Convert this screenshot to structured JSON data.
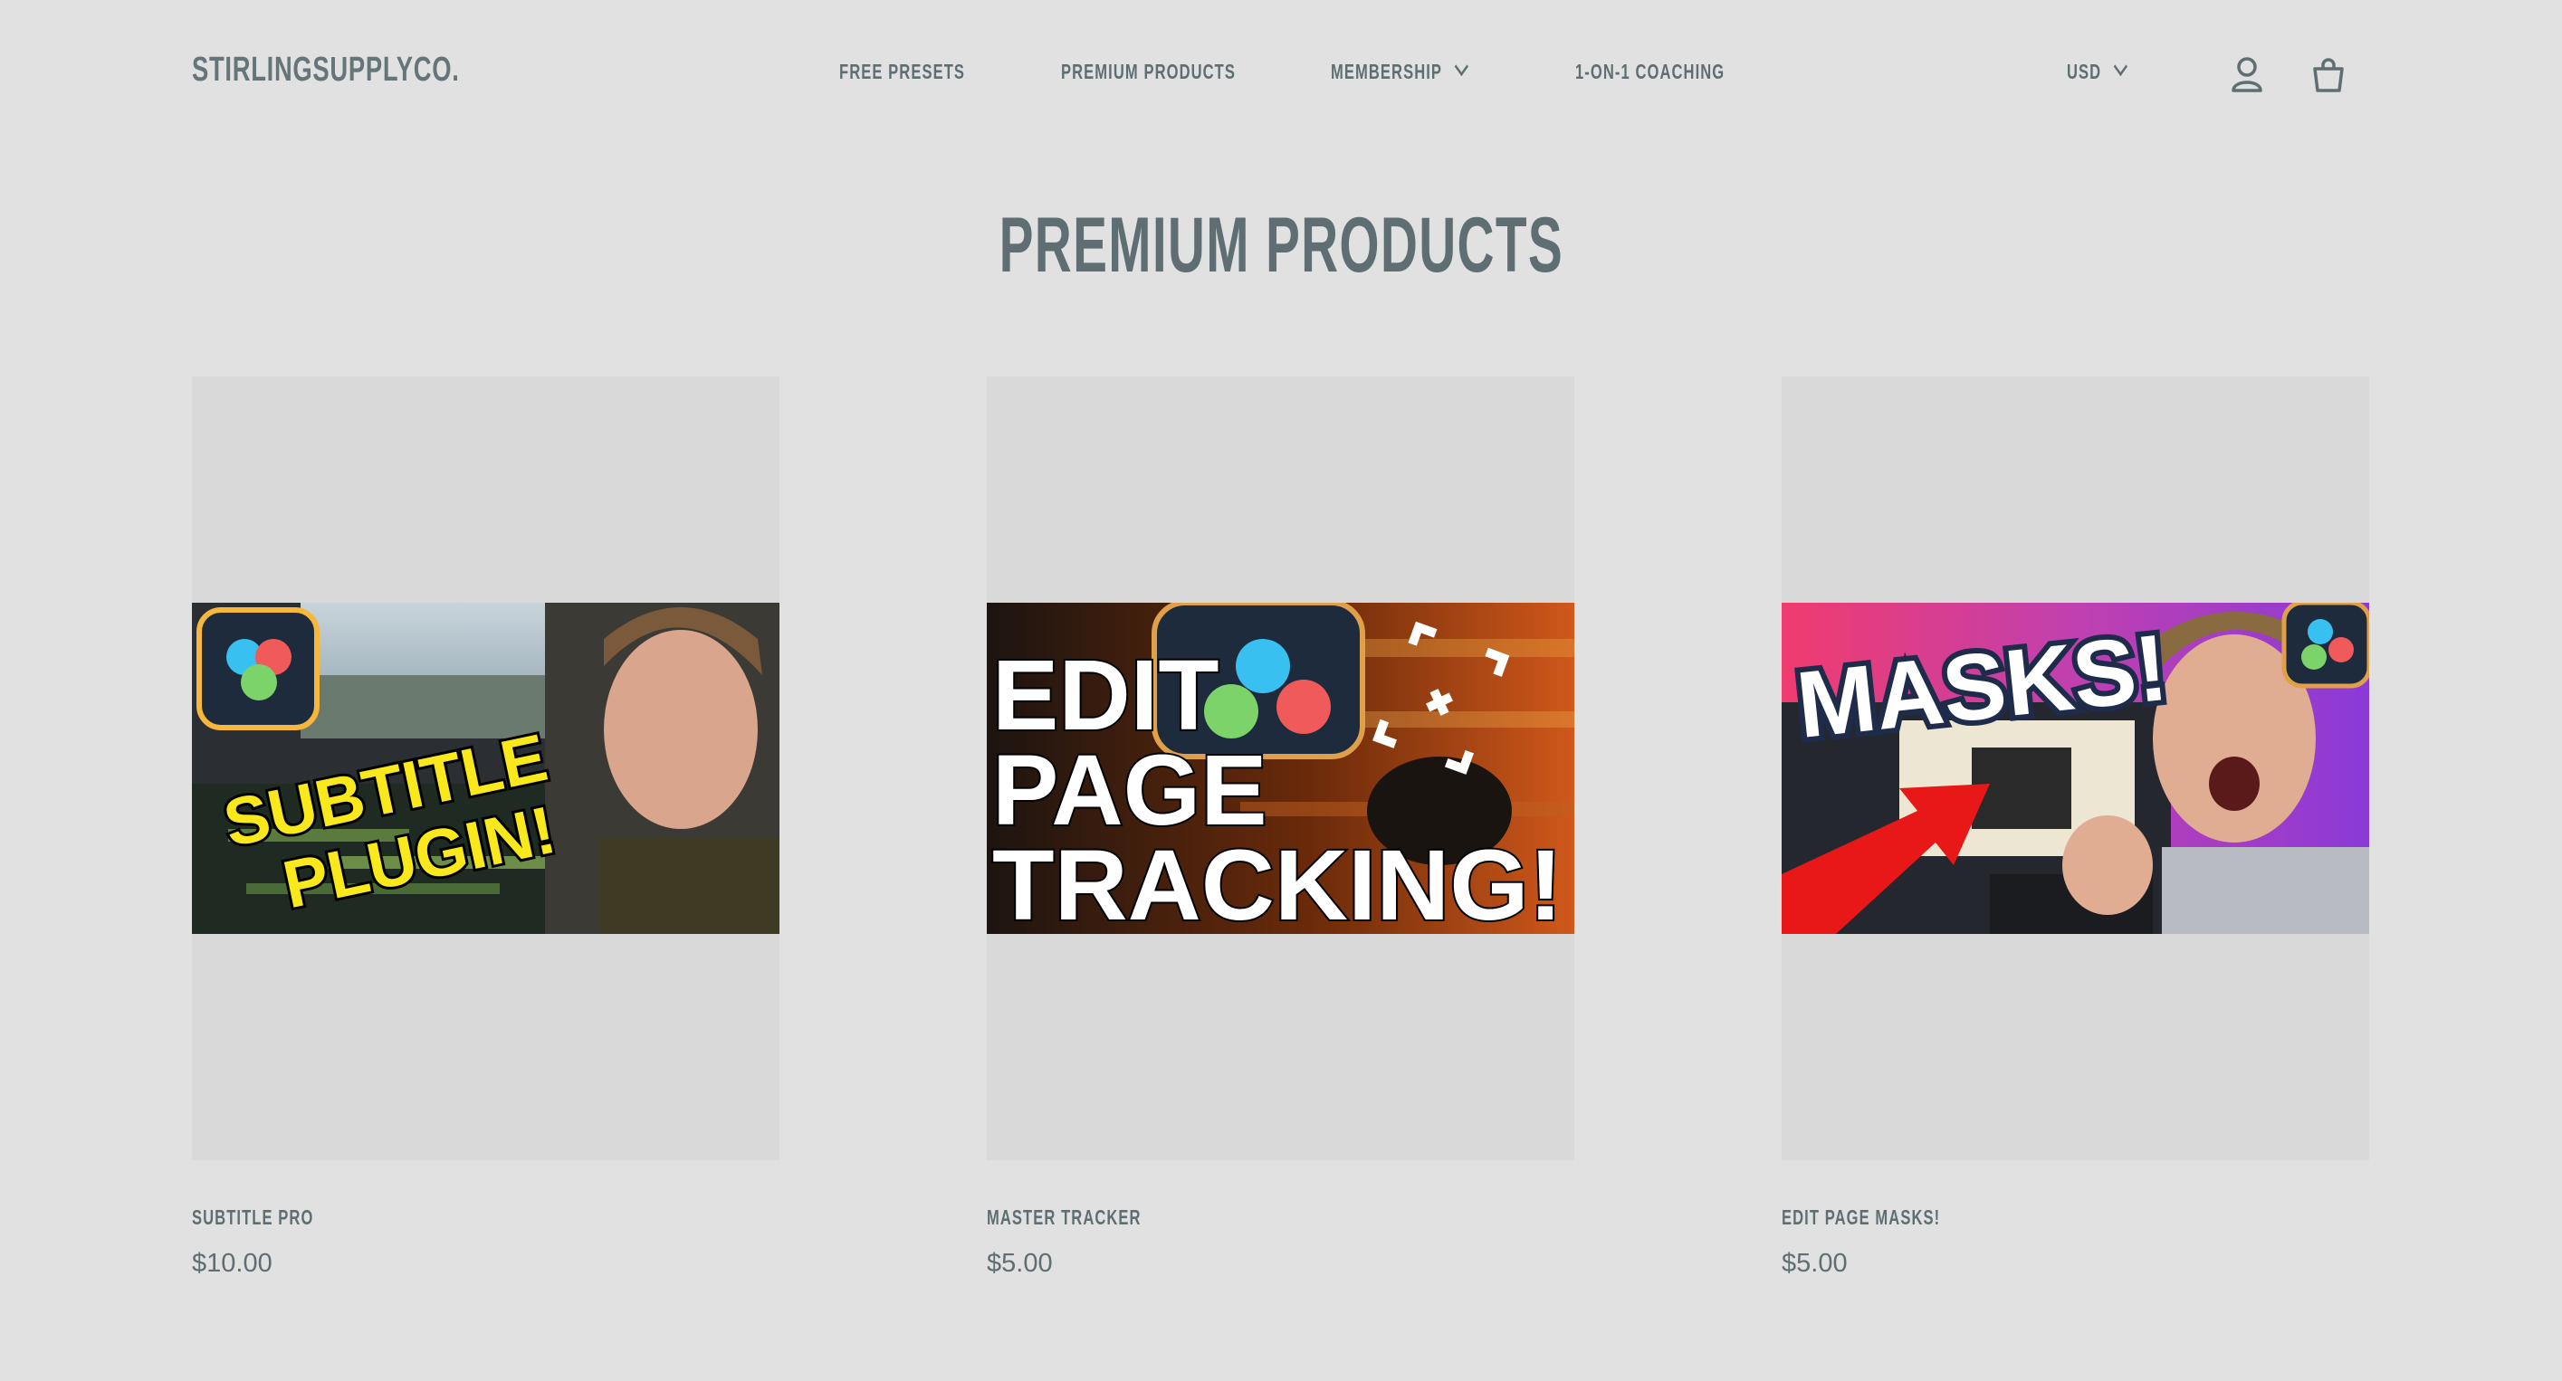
{
  "header": {
    "logo": "STIRLINGSUPPLYCO.",
    "nav": [
      {
        "label": "FREE PRESETS"
      },
      {
        "label": "PREMIUM PRODUCTS"
      },
      {
        "label": "MEMBERSHIP"
      },
      {
        "label": "1-ON-1 COACHING"
      }
    ],
    "currency": "USD",
    "icons": [
      "account-icon",
      "cart-icon"
    ]
  },
  "page": {
    "title": "PREMIUM PRODUCTS"
  },
  "products": [
    {
      "name": "SUBTITLE PRO",
      "price": "$10.00",
      "thumb_text": [
        "SUBTITLE",
        "PLUGIN!"
      ]
    },
    {
      "name": "MASTER TRACKER",
      "price": "$5.00",
      "thumb_text": [
        "EDIT",
        "PAGE",
        "TRACKING!"
      ]
    },
    {
      "name": "EDIT PAGE MASKS!",
      "price": "$5.00",
      "thumb_text": [
        "MASKS!"
      ]
    }
  ],
  "colors": {
    "background": "#e1e1e1",
    "text": "#5f6e72",
    "card_bg": "#d9d9d9"
  }
}
